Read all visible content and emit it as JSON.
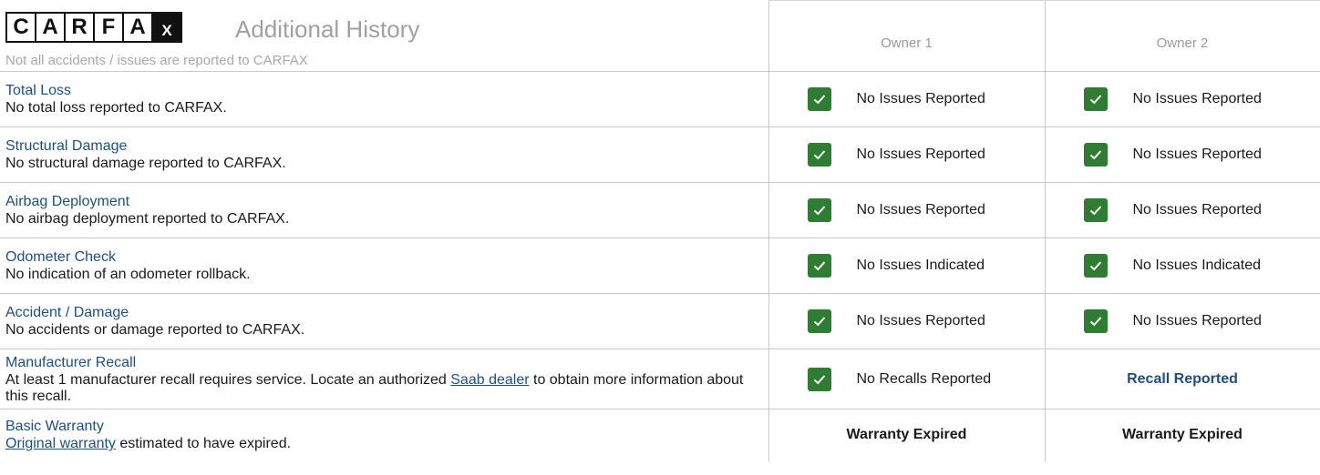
{
  "header": {
    "logo_letters": [
      "C",
      "A",
      "R",
      "F",
      "A",
      "X"
    ],
    "title": "Additional History",
    "subtitle": "Not all accidents / issues are reported to CARFAX",
    "owners": [
      "Owner 1",
      "Owner 2"
    ]
  },
  "colors": {
    "accent": "#1d4f82",
    "check_green": "#2e7d32",
    "muted": "#a0a0a0"
  },
  "rows": [
    {
      "name": "Total Loss",
      "text": "No total loss reported to CARFAX.",
      "owner1": {
        "icon": "check-icon",
        "label": "No Issues Reported"
      },
      "owner2": {
        "icon": "check-icon",
        "label": "No Issues Reported"
      }
    },
    {
      "name": "Structural Damage",
      "text": "No structural damage reported to CARFAX.",
      "owner1": {
        "icon": "check-icon",
        "label": "No Issues Reported"
      },
      "owner2": {
        "icon": "check-icon",
        "label": "No Issues Reported"
      }
    },
    {
      "name": "Airbag Deployment",
      "text": "No airbag deployment reported to CARFAX.",
      "owner1": {
        "icon": "check-icon",
        "label": "No Issues Reported"
      },
      "owner2": {
        "icon": "check-icon",
        "label": "No Issues Reported"
      }
    },
    {
      "name": "Odometer Check",
      "text": "No indication of an odometer rollback.",
      "owner1": {
        "icon": "check-icon",
        "label": "No Issues Indicated"
      },
      "owner2": {
        "icon": "check-icon",
        "label": "No Issues Indicated"
      }
    },
    {
      "name": "Accident / Damage",
      "text": "No accidents or damage reported to CARFAX.",
      "owner1": {
        "icon": "check-icon",
        "label": "No Issues Reported"
      },
      "owner2": {
        "icon": "check-icon",
        "label": "No Issues Reported"
      }
    },
    {
      "name": "Manufacturer Recall",
      "text_before": "At least 1 manufacturer recall requires service. Locate an authorized ",
      "link": "Saab dealer",
      "text_after": " to obtain more information about this recall.",
      "owner1": {
        "icon": "check-icon",
        "label": "No Recalls Reported"
      },
      "owner2": {
        "label": "Recall Reported"
      }
    },
    {
      "name": "Basic Warranty",
      "link": "Original warranty",
      "text_after": " estimated to have expired.",
      "owner1": {
        "label": "Warranty Expired"
      },
      "owner2": {
        "label": "Warranty Expired"
      }
    }
  ]
}
